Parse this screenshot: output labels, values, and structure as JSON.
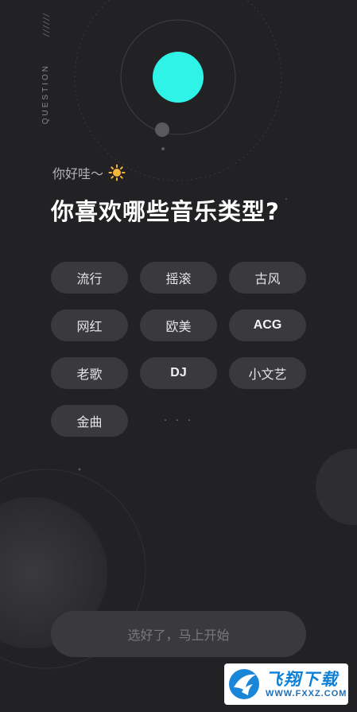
{
  "side_label": "QUESTION",
  "side_slashes": "//////",
  "greeting": "你好哇～",
  "question": "你喜欢哪些音乐类型?",
  "genres": [
    {
      "label": "流行"
    },
    {
      "label": "摇滚"
    },
    {
      "label": "古风"
    },
    {
      "label": "网红"
    },
    {
      "label": "欧美"
    },
    {
      "label": "ACG"
    },
    {
      "label": "老歌"
    },
    {
      "label": "DJ"
    },
    {
      "label": "小文艺"
    },
    {
      "label": "金曲"
    }
  ],
  "more": "· · ·",
  "start_button": "选好了，马上开始",
  "watermark": {
    "title": "飞翔下载",
    "url": "WWW.FXXZ.COM"
  },
  "colors": {
    "background": "#222224",
    "accent_orb": "#2ff3e6",
    "chip": "#3a3a3d",
    "sun": "#f5b63a"
  }
}
